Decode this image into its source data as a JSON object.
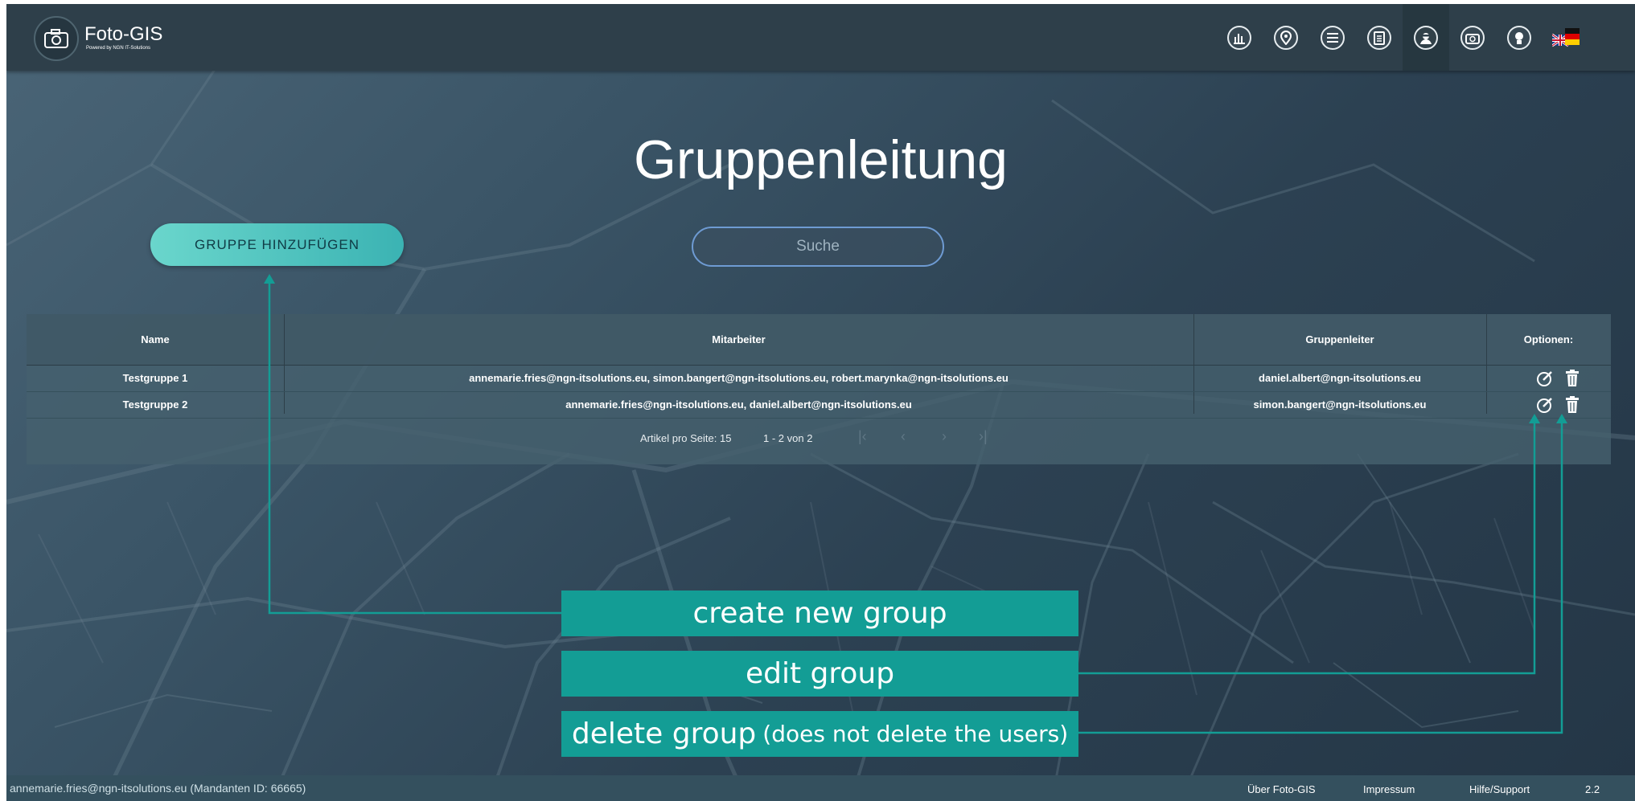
{
  "app": {
    "name": "Foto-GIS",
    "tagline": "Powered by NGN IT-Solutions"
  },
  "nav": {
    "items": [
      {
        "icon": "statistics-icon"
      },
      {
        "icon": "map-pin-icon"
      },
      {
        "icon": "list-icon"
      },
      {
        "icon": "clipboard-icon"
      },
      {
        "icon": "group-leader-icon",
        "active": true
      },
      {
        "icon": "camera-add-icon"
      },
      {
        "icon": "user-profile-icon"
      },
      {
        "icon": "language-flag-icon"
      }
    ]
  },
  "page": {
    "title": "Gruppenleitung",
    "add_button_label": "GRUPPE HINZUFÜGEN",
    "search_placeholder": "Suche"
  },
  "table": {
    "columns": [
      "Name",
      "Mitarbeiter",
      "Gruppenleiter",
      "Optionen:"
    ],
    "rows": [
      {
        "name": "Testgruppe 1",
        "members": "annemarie.fries@ngn-itsolutions.eu, simon.bangert@ngn-itsolutions.eu, robert.marynka@ngn-itsolutions.eu",
        "leader": "daniel.albert@ngn-itsolutions.eu"
      },
      {
        "name": "Testgruppe 2",
        "members": "annemarie.fries@ngn-itsolutions.eu, daniel.albert@ngn-itsolutions.eu",
        "leader": "simon.bangert@ngn-itsolutions.eu"
      }
    ],
    "pagination": {
      "per_page_label": "Artikel pro Seite: 15",
      "range_label": "1 - 2 von 2"
    }
  },
  "annotations": {
    "create": "create new group",
    "edit": "edit group",
    "delete_main": "delete group",
    "delete_note": "(does not delete the users)",
    "color": "#139d95"
  },
  "footer": {
    "user": "annemarie.fries@ngn-itsolutions.eu (Mandanten ID: 66665)",
    "links": [
      "Über Foto-GIS",
      "Impressum",
      "Hilfe/Support"
    ],
    "version": "2.2"
  }
}
